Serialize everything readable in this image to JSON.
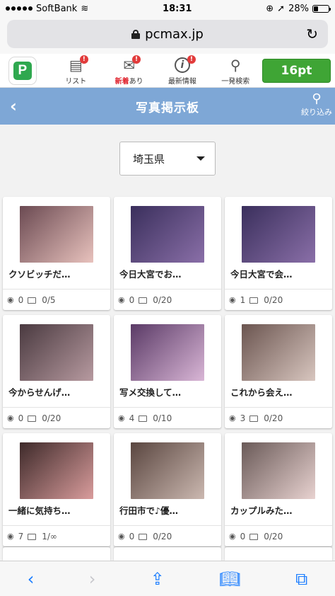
{
  "status": {
    "carrier": "SoftBank",
    "time": "18:31",
    "battery": "28%"
  },
  "browser": {
    "url": "pcmax.jp"
  },
  "nav": {
    "logo": "P",
    "items": [
      {
        "icon": "list-icon",
        "label": "リスト",
        "badge": "!"
      },
      {
        "icon": "mail-icon",
        "label_new": "新着",
        "label_rest": "あり",
        "badge": "!"
      },
      {
        "icon": "info-icon",
        "label": "最新情報",
        "badge": "!"
      },
      {
        "icon": "search-icon",
        "label": "一発検索"
      }
    ],
    "points": "16pt"
  },
  "header": {
    "title": "写真掲示板",
    "filter_label": "絞り込み"
  },
  "prefecture": {
    "selected": "埼玉県"
  },
  "cards": [
    {
      "title": "クソビッチだ…",
      "views": "0",
      "replies": "0/5",
      "c1": "#6b4a52",
      "c2": "#e8c2bd"
    },
    {
      "title": "今日大宮でお…",
      "views": "0",
      "replies": "0/20",
      "c1": "#3a2f5c",
      "c2": "#8a6fa8"
    },
    {
      "title": "今日大宮で会…",
      "views": "1",
      "replies": "0/20",
      "c1": "#3a2f5c",
      "c2": "#8a6fa8"
    },
    {
      "title": "今からせんげ…",
      "views": "0",
      "replies": "0/20",
      "c1": "#4a3a40",
      "c2": "#b79aa0"
    },
    {
      "title": "写メ交換して…",
      "views": "4",
      "replies": "0/10",
      "c1": "#5a3a66",
      "c2": "#d9b6d6"
    },
    {
      "title": "これから会え…",
      "views": "3",
      "replies": "0/20",
      "c1": "#6b5550",
      "c2": "#d8c6bf"
    },
    {
      "title": "一緒に気持ち…",
      "views": "7",
      "replies": "1/∞",
      "c1": "#3e2a2a",
      "c2": "#d99c9c"
    },
    {
      "title": "行田市で♪優…",
      "views": "0",
      "replies": "0/20",
      "c1": "#5a4640",
      "c2": "#cbb8b0"
    },
    {
      "title": "カップルみた…",
      "views": "0",
      "replies": "0/20",
      "c1": "#6a5a58",
      "c2": "#e8d2d0"
    }
  ]
}
